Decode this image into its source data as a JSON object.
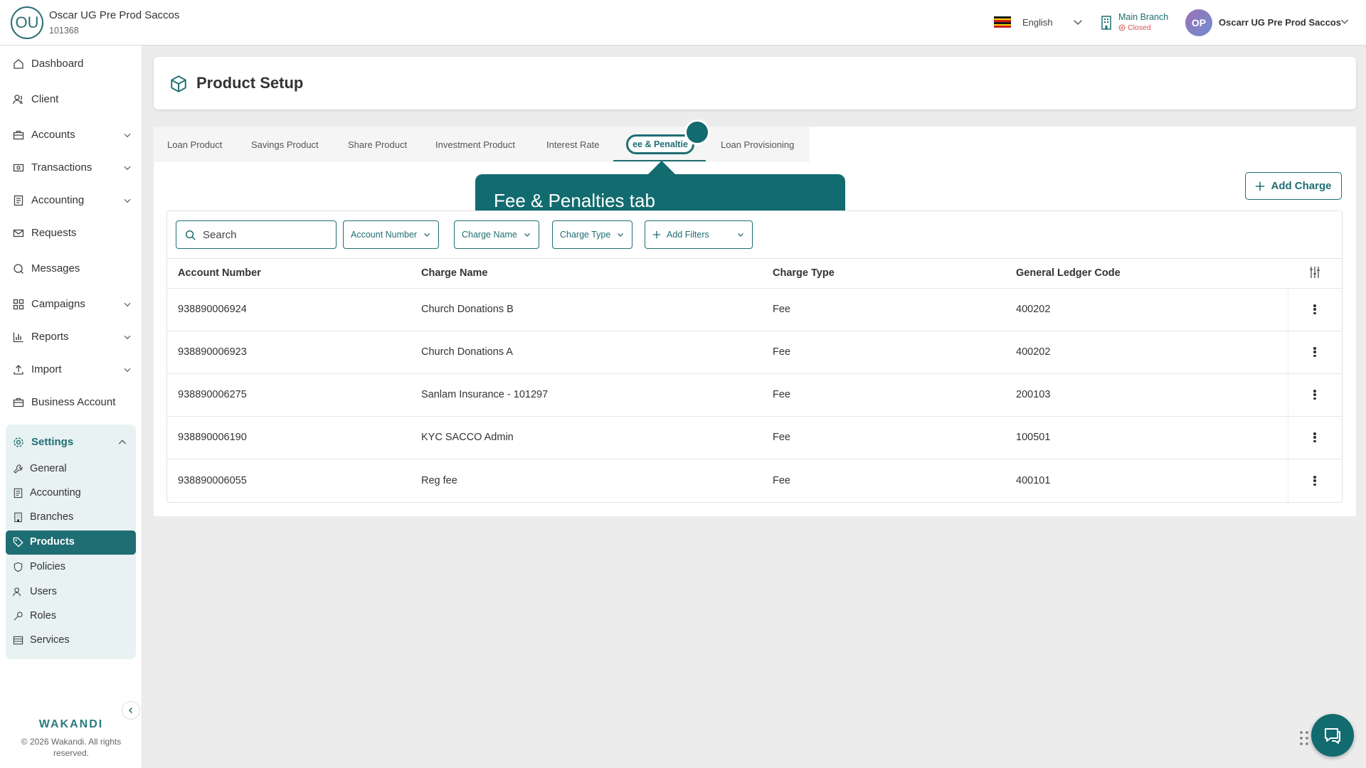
{
  "header": {
    "org_initials": "OU",
    "org_name": "Oscar UG Pre Prod Saccos",
    "org_id": "101368",
    "language": "English",
    "branch_name": "Main Branch",
    "branch_status": "Closed",
    "user_initials": "OP",
    "user_name": "Oscarr UG Pre Prod Saccos",
    "flag_colors": [
      "#1a1a1a",
      "#f6d103",
      "#d0201c",
      "#1a1a1a",
      "#f6d103",
      "#d0201c"
    ]
  },
  "sidebar": {
    "items": [
      {
        "label": "Dashboard",
        "icon": "home-icon"
      },
      {
        "label": "Client",
        "icon": "users-icon"
      },
      {
        "label": "Accounts",
        "icon": "briefcase-icon"
      },
      {
        "label": "Transactions",
        "icon": "cash-icon"
      },
      {
        "label": "Accounting",
        "icon": "ledger-icon"
      },
      {
        "label": "Requests",
        "icon": "mail-icon"
      },
      {
        "label": "Messages",
        "icon": "chat-icon"
      },
      {
        "label": "Campaigns",
        "icon": "grid-icon"
      },
      {
        "label": "Reports",
        "icon": "bar-chart-icon"
      },
      {
        "label": "Import",
        "icon": "upload-icon"
      },
      {
        "label": "Business Account",
        "icon": "briefcase-icon"
      }
    ],
    "settings": {
      "label": "Settings",
      "items": [
        {
          "label": "General",
          "icon": "wrench-icon"
        },
        {
          "label": "Accounting",
          "icon": "ledger-icon"
        },
        {
          "label": "Branches",
          "icon": "building-icon"
        },
        {
          "label": "Products",
          "icon": "tag-icon"
        },
        {
          "label": "Policies",
          "icon": "shield-icon"
        },
        {
          "label": "Users",
          "icon": "users-icon"
        },
        {
          "label": "Roles",
          "icon": "key-icon"
        },
        {
          "label": "Services",
          "icon": "list-icon"
        }
      ]
    },
    "brand": "WAKANDI",
    "copyright": "© 2026 Wakandi. All rights reserved."
  },
  "page": {
    "title": "Product Setup"
  },
  "tabs": [
    "Loan Product",
    "Savings Product",
    "Share Product",
    "Investment Product",
    "Interest Rate",
    "Fee & Penalties",
    "Loan Provisioning"
  ],
  "active_tab_visible_text": "ee & Penaltie",
  "tooltip": "Fee & Penalties tab",
  "actions": {
    "add_charge": "Add Charge"
  },
  "filters": {
    "search_placeholder": "Search",
    "account_number": "Account Number",
    "charge_name": "Charge Name",
    "charge_type": "Charge Type",
    "add_filters": "Add Filters"
  },
  "table": {
    "columns": [
      "Account Number",
      "Charge Name",
      "Charge Type",
      "General Ledger Code"
    ],
    "rows": [
      [
        "938890006924",
        "Church Donations B",
        "Fee",
        "400202"
      ],
      [
        "938890006923",
        "Church Donations A",
        "Fee",
        "400202"
      ],
      [
        "938890006275",
        "Sanlam Insurance - 101297",
        "Fee",
        "200103"
      ],
      [
        "938890006190",
        "KYC SACCO Admin",
        "Fee",
        "100501"
      ],
      [
        "938890006055",
        "Reg fee",
        "Fee",
        "400101"
      ]
    ]
  },
  "accent_color": "#1f6e73"
}
